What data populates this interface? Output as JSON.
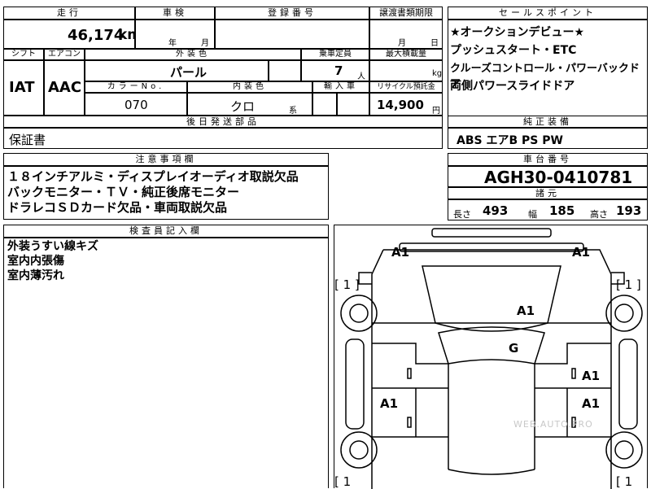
{
  "headers": {
    "mileage": "走行",
    "inspection": "車検",
    "registration": "登録番号",
    "transfer_deadline": "譲渡書類期限",
    "sales_point": "セールスポイント",
    "shift": "シフト",
    "aircon": "エアコン",
    "exterior_color": "外装色",
    "seats": "乗車定員",
    "max_load": "最大積載量",
    "color_no": "カラーNo.",
    "interior_color": "内装色",
    "import": "輸入車",
    "recycle": "リサイクル預託金",
    "later_parts": "後日発送部品",
    "standard_equipment": "純正装備",
    "notes": "注意事項欄",
    "chassis": "車台番号",
    "specs": "諸元",
    "inspector": "検査員記入欄"
  },
  "values": {
    "mileage": "46,174",
    "mileage_unit": "km",
    "year_label": "年",
    "month_label": "月",
    "transfer_month": "月",
    "transfer_day": "日",
    "shift": "IAT",
    "aircon": "AAC",
    "exterior_color": "パール",
    "seats": "7",
    "seats_unit": "人",
    "max_load_unit": "kg",
    "color_no": "070",
    "interior_color": "クロ",
    "interior_suffix": "系",
    "recycle": "14,900",
    "recycle_unit": "円",
    "later_parts": "保証書",
    "standard_equipment": "ABS エアB PS PW",
    "chassis": "AGH30-0410781",
    "length_label": "長さ",
    "length": "493",
    "width_label": "幅",
    "width": "185",
    "height_label": "高さ",
    "height": "193"
  },
  "sales_points": [
    "★オークションデビュー★",
    "プッシュスタート・ETC",
    "クルーズコントロール・パワーバックドア",
    "両側パワースライドドア"
  ],
  "notes": [
    "１８インチアルミ・ディスプレイオーディオ取説欠品",
    "バックモニター・ＴＶ・純正後席モニター",
    "ドラレコＳＤカード欠品・車両取説欠品"
  ],
  "inspector_notes": [
    "外装うすい線キズ",
    "室内内張傷",
    "室内薄汚れ"
  ],
  "diagram": {
    "marks": {
      "a1_front_left": "A1",
      "a1_front_right": "A1",
      "a1_hood": "A1",
      "g_windshield": "G",
      "a1_right_front_door": "A1",
      "a1_left_rear": "A1",
      "a1_right_rear": "A1"
    },
    "tire_left_top": "[ 1 ]",
    "tire_right_top": "[ 1 ]",
    "tire_left_bottom": "[ 1",
    "tire_right_bottom": "[ 1",
    "watermark": "WEB.AUTO.PRO"
  }
}
